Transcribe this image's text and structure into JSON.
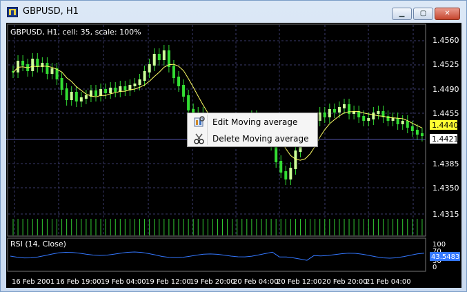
{
  "window": {
    "title": "GBPUSD, H1"
  },
  "chart": {
    "info": "GBPUSD, H1, cell: 35, scale: 100%",
    "price_ticks": [
      "1.4560",
      "1.4525",
      "1.4490",
      "1.4455",
      "1.4385",
      "1.4350",
      "1.4315"
    ],
    "ma_price_label": "1.4440",
    "last_price_label": "1.4421",
    "time_ticks": [
      "16 Feb 2001",
      "16 Feb 19:00",
      "19 Feb 04:00",
      "19 Feb 12:00",
      "19 Feb 20:00",
      "20 Feb 04:00",
      "20 Feb 12:00",
      "20 Feb 20:00",
      "21 Feb 04:00"
    ]
  },
  "rsi": {
    "title": "RSI (14, Close)",
    "ticks": [
      "100",
      "70",
      "30",
      "0"
    ],
    "value_label": "43.5483"
  },
  "context_menu": {
    "items": [
      {
        "label": "Edit Moving average",
        "icon": "edit-properties-icon"
      },
      {
        "label": "Delete Moving average",
        "icon": "scissors-icon"
      }
    ]
  },
  "colors": {
    "bull_candle": "#ccff99",
    "bear_candle": "#33dd33",
    "moving_average": "#ffff66",
    "rsi_line": "#3377ff",
    "grid": "#3a3a6a",
    "price_line": "#5555aa"
  }
}
